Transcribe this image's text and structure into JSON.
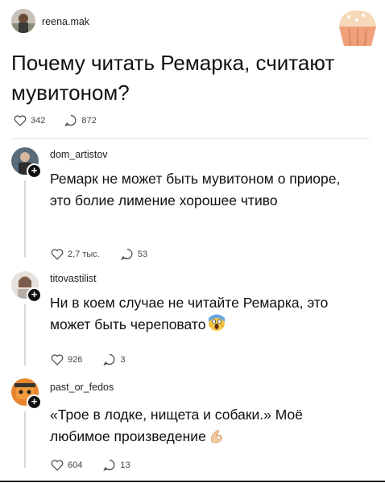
{
  "post": {
    "author": "reena.mak",
    "title": "Почему читать Ремарка, считают мувитоном?",
    "likes": "342",
    "replies": "872"
  },
  "comments": [
    {
      "author": "dom_artistov",
      "text": "Ремарк не может быть мувитоном о приоре, это болие лимение хорошее чтиво",
      "likes": "2,7 тыс.",
      "replies": "53"
    },
    {
      "author": "titovastilist",
      "text": "Ни в коем случае не читайте Ремарка, это может быть череповато",
      "emoji": "screaming-face-emoji",
      "likes": "926",
      "replies": "3"
    },
    {
      "author": "past_or_fedos",
      "text": "«Трое в лодке, нищета и собаки.» Моё любимое произведение",
      "emoji": "ok-hand-emoji",
      "likes": "604",
      "replies": "13"
    }
  ]
}
